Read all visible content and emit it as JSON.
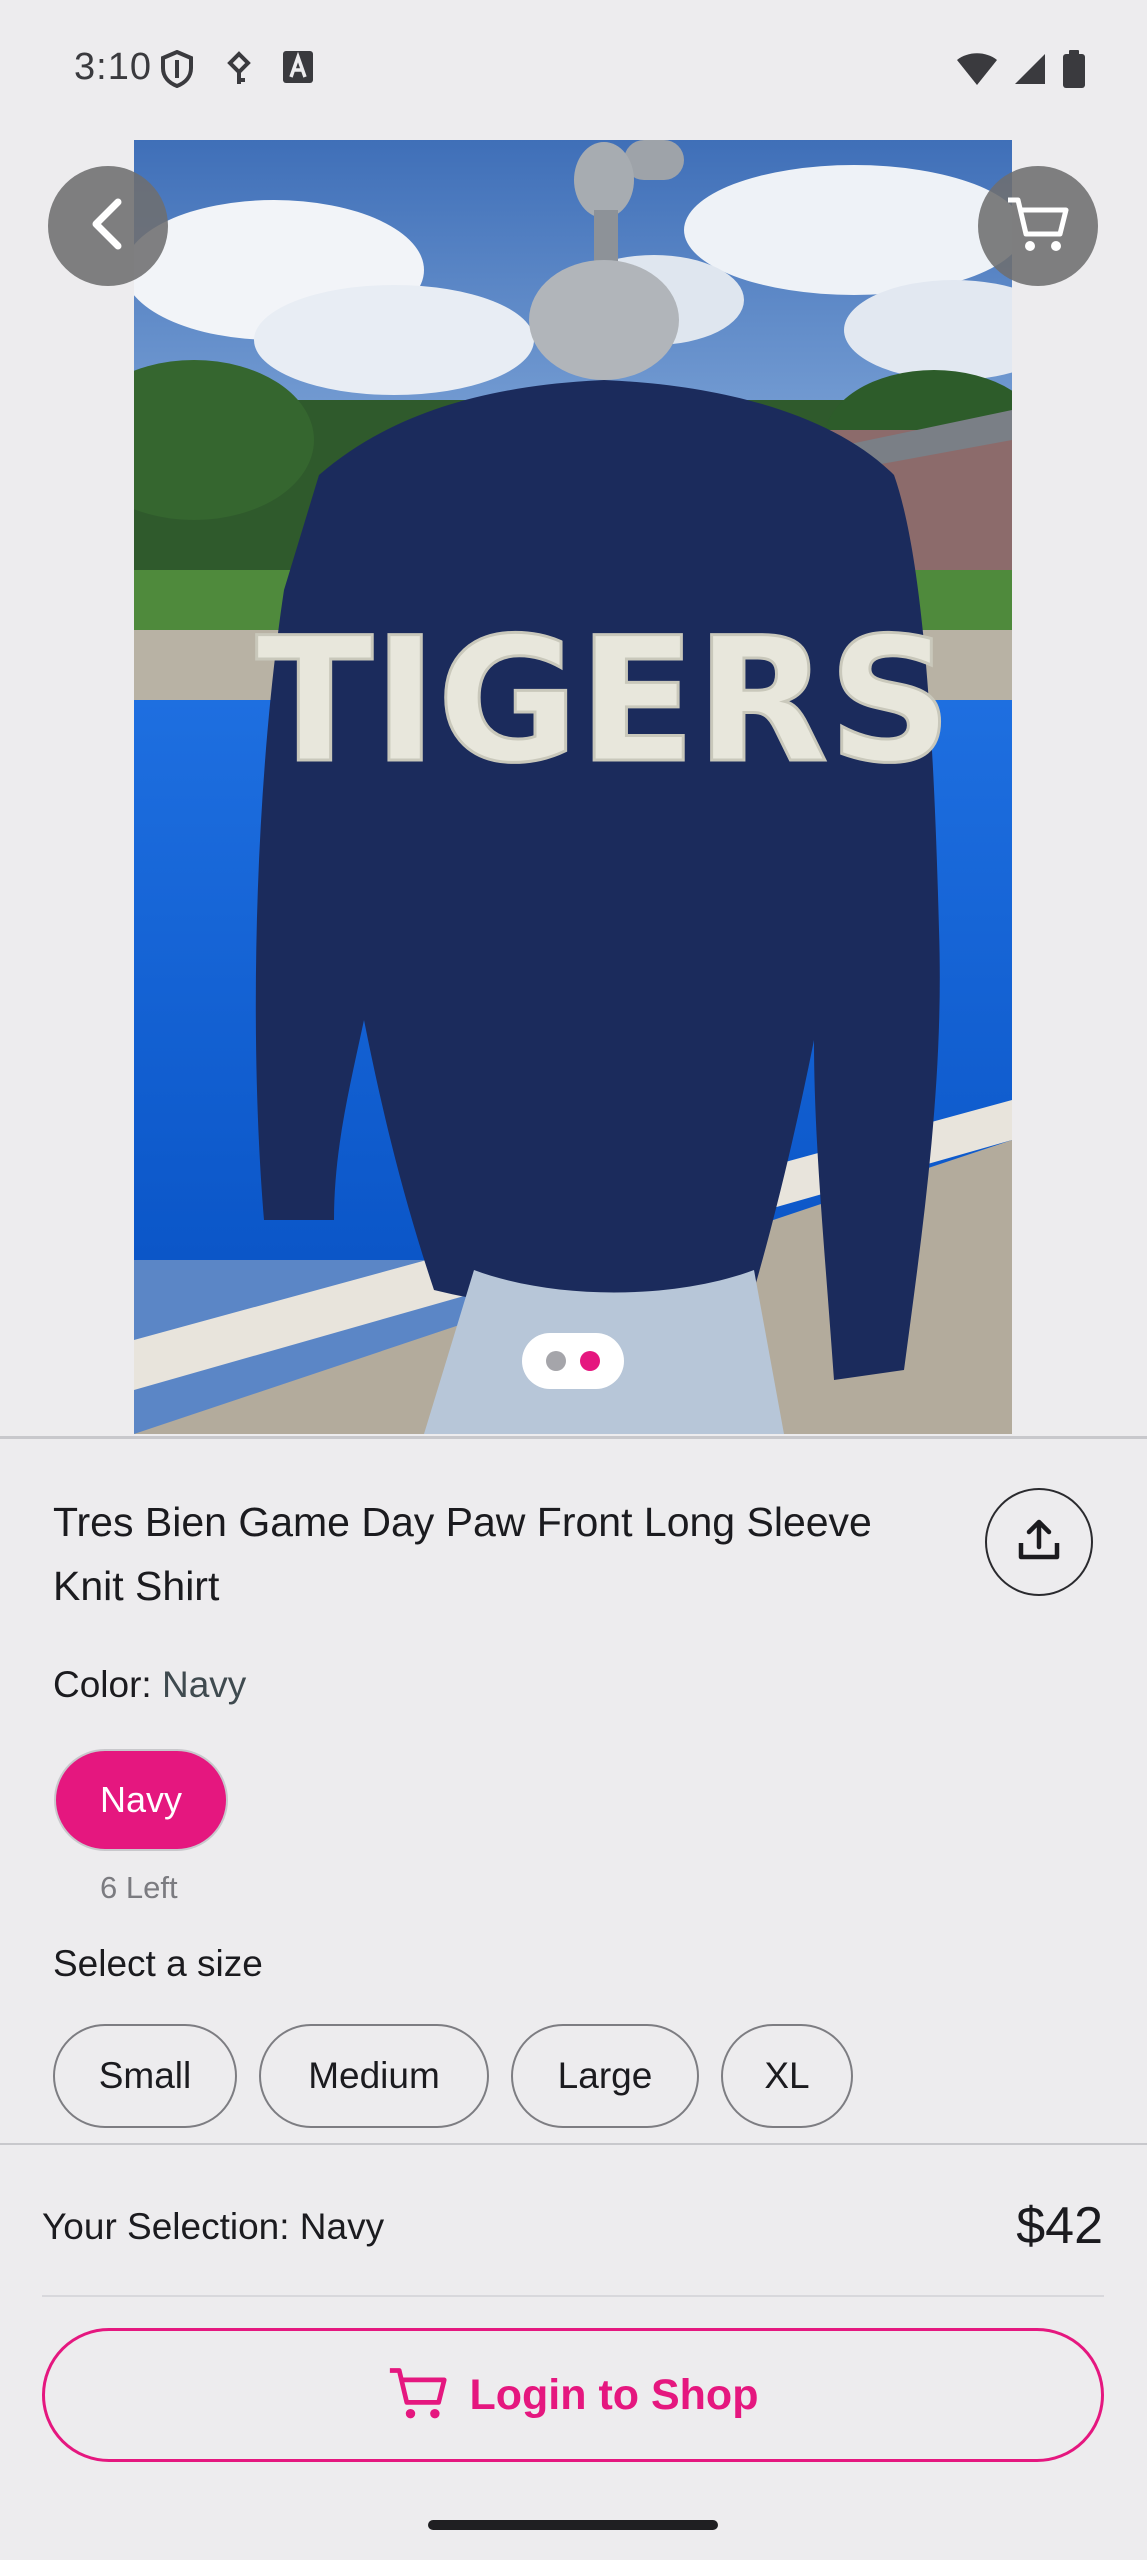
{
  "status_bar": {
    "time": "3:10"
  },
  "product": {
    "title": "Tres Bien Game Day Paw Front Long Sleeve Knit Shirt",
    "image_text": "TIGERS",
    "color_label": "Color:",
    "color_value": "Navy",
    "color_options": [
      {
        "label": "Navy",
        "stock": "6 Left"
      }
    ],
    "size_heading": "Select a size",
    "sizes": [
      "Small",
      "Medium",
      "Large",
      "XL"
    ]
  },
  "footer": {
    "selection_text": "Your Selection: Navy",
    "price": "$42",
    "cta_label": "Login to Shop"
  },
  "colors": {
    "accent": "#e5177f",
    "background": "#edecee"
  },
  "icons": {
    "back": "chevron-left-icon",
    "cart": "cart-icon",
    "share": "share-icon"
  }
}
